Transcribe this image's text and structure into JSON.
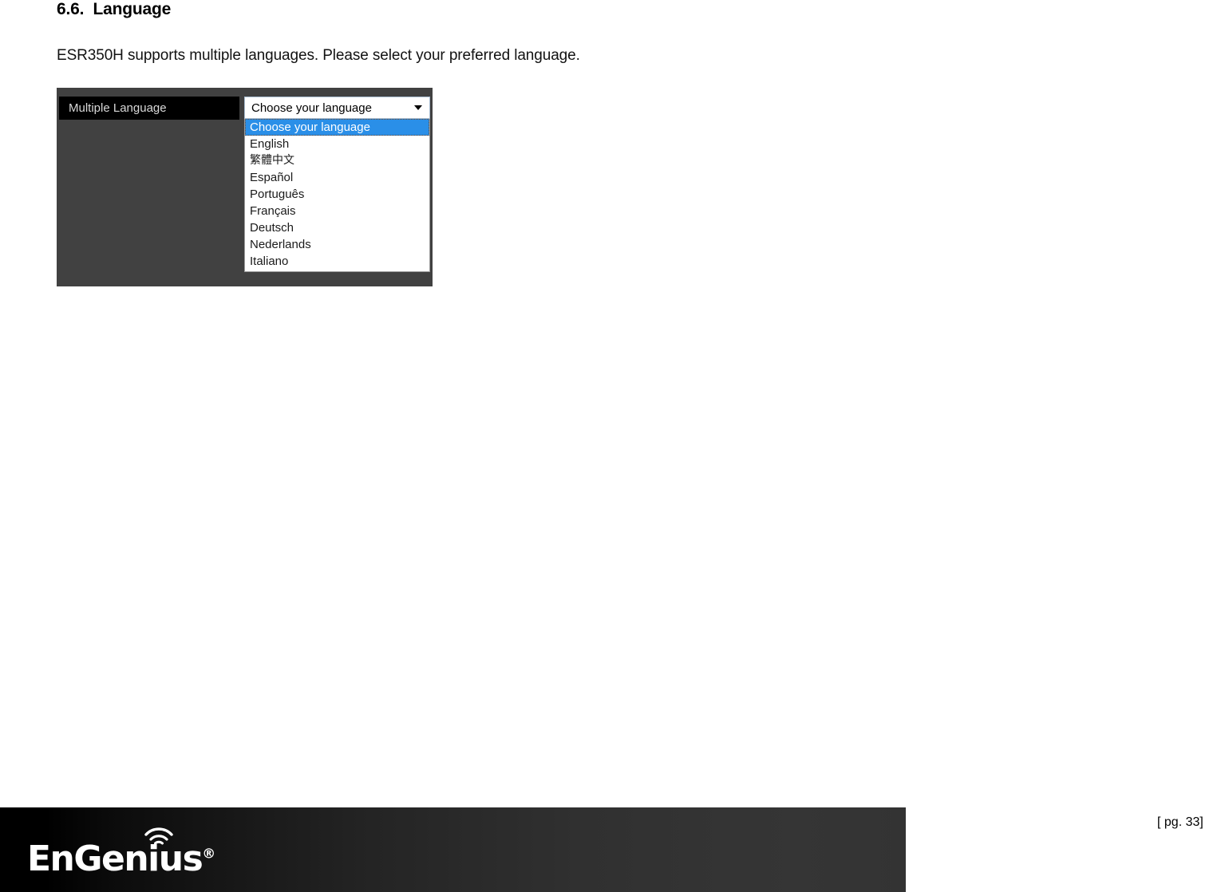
{
  "document": {
    "section_number": "6.6.",
    "section_title": "Language",
    "heading": "6.6.  Language",
    "body_paragraph": "ESR350H supports multiple languages. Please select your preferred language."
  },
  "figure": {
    "panel_background": "#414141",
    "setting_label": "Multiple Language",
    "select": {
      "selected_value": "Choose your language",
      "arrow_icon": "chevron-down-icon",
      "highlight_color": "#2a8fe8",
      "options": [
        {
          "label": "Choose your language",
          "selected": true,
          "cjk": false
        },
        {
          "label": "English",
          "selected": false,
          "cjk": false
        },
        {
          "label": "繁體中文",
          "selected": false,
          "cjk": true
        },
        {
          "label": "Español",
          "selected": false,
          "cjk": false
        },
        {
          "label": "Português",
          "selected": false,
          "cjk": false
        },
        {
          "label": "Français",
          "selected": false,
          "cjk": false
        },
        {
          "label": "Deutsch",
          "selected": false,
          "cjk": false
        },
        {
          "label": "Nederlands",
          "selected": false,
          "cjk": false
        },
        {
          "label": "Italiano",
          "selected": false,
          "cjk": false
        }
      ]
    }
  },
  "footer": {
    "brand": "EnGenius",
    "registered_mark": "®",
    "wifi_icon": "wifi-signal-icon",
    "page_label": "[ pg. 33]"
  }
}
